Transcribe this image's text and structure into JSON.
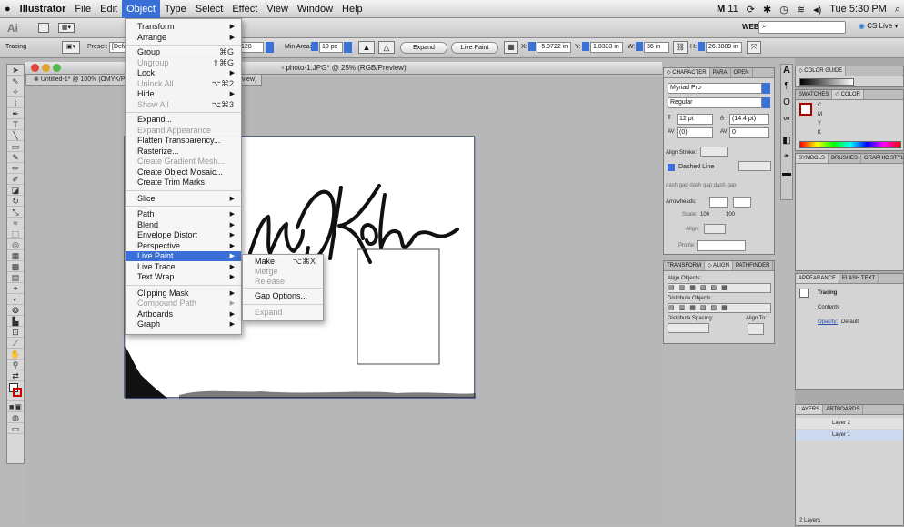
{
  "menubar": {
    "apple": "",
    "items": [
      "Illustrator",
      "File",
      "Edit",
      "Object",
      "Type",
      "Select",
      "Effect",
      "View",
      "Window",
      "Help"
    ],
    "active": "Object",
    "right": {
      "status": "11",
      "clock": "Tue 5:30 PM"
    }
  },
  "appbar": {
    "ai": "Ai",
    "workspace": "WEB ▾",
    "cslive": "CS Live ▾"
  },
  "controlbar": {
    "mode": "Tracing",
    "preset_label": "Preset:",
    "preset_value": "[Defau",
    "threshold": "128",
    "min_area_label": "Min Area:",
    "min_area": "10 px",
    "expand": "Expand",
    "live_paint": "Live Paint",
    "x_label": "X:",
    "x": "-5.9722 in",
    "y_label": "Y:",
    "y": "1.8333 in",
    "w_label": "W:",
    "w": "36 in",
    "h_label": "H:",
    "h": "26.8889 in"
  },
  "document": {
    "title": "photo-1.JPG* @ 25% (RGB/Preview)",
    "tab": "Untitled-1* @ 100% (CMYK/Pre",
    "tab2": "view)"
  },
  "object_menu": {
    "items": [
      {
        "label": "Transform",
        "sc": "",
        "sub": true,
        "dis": false
      },
      {
        "label": "Arrange",
        "sc": "",
        "sub": true,
        "dis": false
      },
      {
        "label": "Group",
        "sc": "⌘G",
        "sub": false,
        "dis": false
      },
      {
        "label": "Ungroup",
        "sc": "⇧⌘G",
        "sub": false,
        "dis": true
      },
      {
        "label": "Lock",
        "sc": "",
        "sub": true,
        "dis": false
      },
      {
        "label": "Unlock All",
        "sc": "⌥⌘2",
        "sub": false,
        "dis": true
      },
      {
        "label": "Hide",
        "sc": "",
        "sub": true,
        "dis": false
      },
      {
        "label": "Show All",
        "sc": "⌥⌘3",
        "sub": false,
        "dis": true
      },
      {
        "label": "Expand...",
        "sc": "",
        "sub": false,
        "dis": false
      },
      {
        "label": "Expand Appearance",
        "sc": "",
        "sub": false,
        "dis": true
      },
      {
        "label": "Flatten Transparency...",
        "sc": "",
        "sub": false,
        "dis": false
      },
      {
        "label": "Rasterize...",
        "sc": "",
        "sub": false,
        "dis": false
      },
      {
        "label": "Create Gradient Mesh...",
        "sc": "",
        "sub": false,
        "dis": true
      },
      {
        "label": "Create Object Mosaic...",
        "sc": "",
        "sub": false,
        "dis": false
      },
      {
        "label": "Create Trim Marks",
        "sc": "",
        "sub": false,
        "dis": false
      },
      {
        "label": "Slice",
        "sc": "",
        "sub": true,
        "dis": false
      },
      {
        "label": "Path",
        "sc": "",
        "sub": true,
        "dis": false
      },
      {
        "label": "Blend",
        "sc": "",
        "sub": true,
        "dis": false
      },
      {
        "label": "Envelope Distort",
        "sc": "",
        "sub": true,
        "dis": false
      },
      {
        "label": "Perspective",
        "sc": "",
        "sub": true,
        "dis": false
      },
      {
        "label": "Live Paint",
        "sc": "",
        "sub": true,
        "dis": false,
        "hl": true
      },
      {
        "label": "Live Trace",
        "sc": "",
        "sub": true,
        "dis": false
      },
      {
        "label": "Text Wrap",
        "sc": "",
        "sub": true,
        "dis": false
      },
      {
        "label": "Clipping Mask",
        "sc": "",
        "sub": true,
        "dis": false
      },
      {
        "label": "Compound Path",
        "sc": "",
        "sub": true,
        "dis": true
      },
      {
        "label": "Artboards",
        "sc": "",
        "sub": true,
        "dis": false
      },
      {
        "label": "Graph",
        "sc": "",
        "sub": true,
        "dis": false
      }
    ]
  },
  "live_paint_menu": {
    "items": [
      {
        "label": "Make",
        "sc": "⌥⌘X",
        "dis": false
      },
      {
        "label": "Merge",
        "sc": "",
        "dis": true
      },
      {
        "label": "Release",
        "sc": "",
        "dis": true
      },
      {
        "label": "Gap Options...",
        "sc": "",
        "dis": false
      },
      {
        "label": "Expand",
        "sc": "",
        "dis": true
      }
    ]
  },
  "character_panel": {
    "tabs": [
      "◇ CHARACTER",
      "PARA",
      "OPEN"
    ],
    "font": "Myriad Pro",
    "style": "Regular",
    "size": "12 pt",
    "leading": "(14.4 pt)",
    "kerning": "(0)",
    "tracking": "0",
    "align_stroke": "Align Stroke:",
    "dashed_line": "Dashed Line",
    "dash_labels": [
      "dash",
      "gap",
      "dash",
      "gap",
      "dash",
      "gap"
    ],
    "arrowheads": "Arrowheads:",
    "scale_label": "Scale:",
    "scale_1": "100",
    "scale_2": "100",
    "align_label": "Align:",
    "profile_label": "Profile:"
  },
  "align_panel": {
    "tabs": [
      "TRANSFORM",
      "◇ ALIGN",
      "PATHFINDER"
    ],
    "align_objects": "Align Objects:",
    "distribute_objects": "Distribute Objects:",
    "distribute_spacing": "Distribute Spacing:",
    "align_to": "Align To:"
  },
  "color_guide": {
    "title": "◇ COLOR GUIDE"
  },
  "swatches_color": {
    "tabs": [
      "SWATCHES",
      "◇ COLOR"
    ],
    "channels": [
      "C",
      "M",
      "Y",
      "K"
    ]
  },
  "symbols": {
    "tabs": [
      "SYMBOLS",
      "BRUSHES",
      "GRAPHIC STYL"
    ]
  },
  "appearance": {
    "tabs": [
      "APPEARANCE",
      "FLASH TEXT"
    ],
    "title": "Tracing",
    "contents": "Contents",
    "opacity_label": "Opacity:",
    "opacity_value": "Default"
  },
  "layers": {
    "tabs": [
      "LAYERS",
      "ARTBOARDS"
    ],
    "rows": [
      "Layer 2",
      "Layer 1"
    ],
    "footer": "2 Layers"
  }
}
